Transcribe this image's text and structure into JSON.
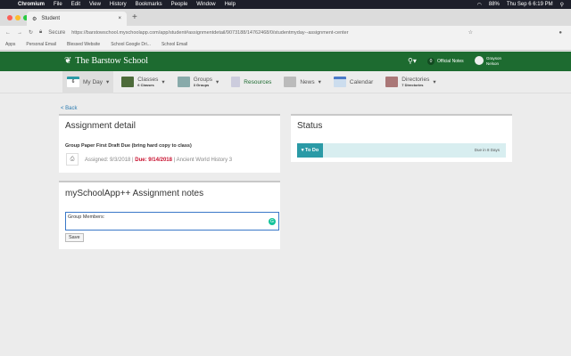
{
  "menubar": {
    "app": "Chromium",
    "items": [
      "File",
      "Edit",
      "View",
      "History",
      "Bookmarks",
      "People",
      "Window",
      "Help"
    ],
    "battery": "88%",
    "clock": "Thu Sep 6  6:19 PM"
  },
  "browser": {
    "tab_title": "Student",
    "url_secure": "Secure",
    "url": "https://barstowschool.myschoolapp.com/app/student#assignmentdetail/9073188/14762468/0/studentmyday--assignment-center",
    "bookmarks": [
      "Apps",
      "Personal Email",
      "Blessed Website",
      "School Google Dri...",
      "School Email"
    ]
  },
  "header": {
    "school": "The Barstow School",
    "official_notes_count": "0",
    "official_notes": "Official Notes",
    "user_first": "Grayson",
    "user_last": "Nelson"
  },
  "nav": [
    {
      "label": "My Day",
      "sub": "",
      "day": "6"
    },
    {
      "label": "Classes",
      "sub": "6 Classes"
    },
    {
      "label": "Groups",
      "sub": "3 Groups"
    },
    {
      "label": "Resources",
      "sub": ""
    },
    {
      "label": "News",
      "sub": ""
    },
    {
      "label": "Calendar",
      "sub": ""
    },
    {
      "label": "Directories",
      "sub": "7 Directories"
    }
  ],
  "back": "< Back",
  "detail": {
    "title": "Assignment detail",
    "assignment": "Group Paper First Draft Due (bring hard copy to class)",
    "assigned": "Assigned: 9/3/2018",
    "sep": "|",
    "due": "Due: 9/14/2018",
    "class": "Ancient World History 3"
  },
  "notes": {
    "title": "mySchoolApp++ Assignment notes",
    "value": "Group Members:",
    "save": "Save"
  },
  "status": {
    "title": "Status",
    "button": "▾ To Do",
    "due_in": "Due in 8 Days"
  },
  "colors": {
    "green": "#1d6b30",
    "teal": "#2a9aa6",
    "red": "#c8102e"
  }
}
